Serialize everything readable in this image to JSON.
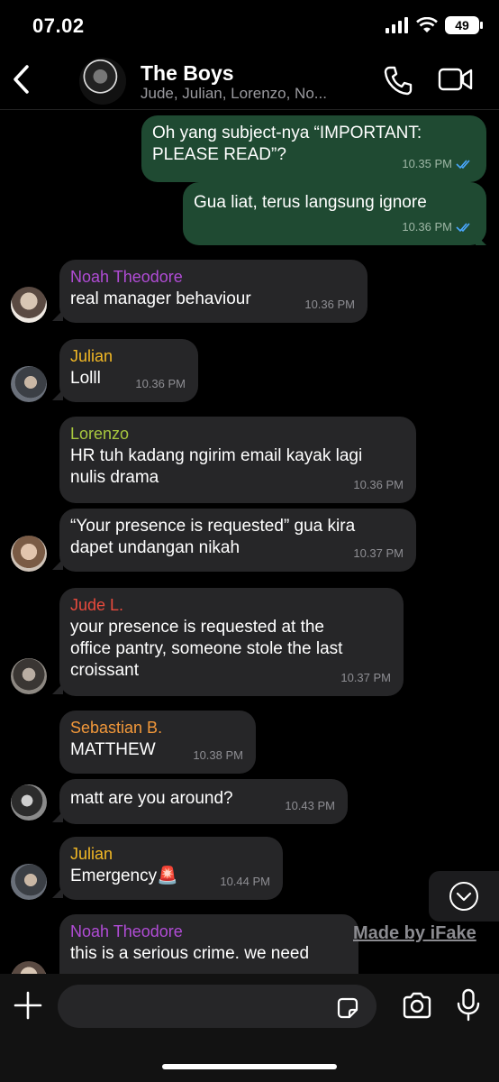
{
  "status_bar": {
    "time": "07.02",
    "battery": "49"
  },
  "header": {
    "title": "The Boys",
    "subtitle": "Jude, Julian, Lorenzo, No..."
  },
  "messages": [
    {
      "text": "Oh yang subject-nya “IMPORTANT:\nPLEASE READ”?",
      "time": "10.35 PM"
    },
    {
      "text": "Gua liat, terus langsung ignore",
      "time": "10.36 PM"
    },
    {
      "sender": "Noah Theodore",
      "text": "real manager behaviour",
      "time": "10.36 PM"
    },
    {
      "sender": "Julian",
      "text": "Lolll",
      "time": "10.36 PM"
    },
    {
      "sender": "Lorenzo",
      "text": "HR tuh kadang ngirim email kayak lagi\nnulis drama",
      "time": "10.36 PM"
    },
    {
      "text": "“Your presence is requested” gua kira\ndapet undangan nikah",
      "time": "10.37 PM"
    },
    {
      "sender": "Jude L.",
      "text": "your presence is requested at the\noffice pantry, someone stole the last\ncroissant",
      "time": "10.37 PM"
    },
    {
      "sender": "Sebastian B.",
      "text": "MATTHEW",
      "time": "10.38 PM"
    },
    {
      "text": "matt are you around?",
      "time": "10.43 PM"
    },
    {
      "sender": "Julian",
      "text": "Emergency🚨",
      "time": "10.44 PM"
    },
    {
      "sender": "Noah Theodore",
      "text": "this is a serious crime. we need"
    }
  ],
  "sender_colors": {
    "Noah Theodore": "#b14cd6",
    "Julian": "#f2b825",
    "Lorenzo": "#a8c73e",
    "Jude L.": "#e84a3d",
    "Sebastian B.": "#f2983a"
  },
  "watermark": "Made by iFake",
  "composer": {
    "placeholder": ""
  },
  "icons": [
    "back-icon",
    "phone-icon",
    "video-icon",
    "read-receipt-icon",
    "scroll-down-icon",
    "plus-icon",
    "sticker-icon",
    "camera-icon",
    "mic-icon"
  ]
}
